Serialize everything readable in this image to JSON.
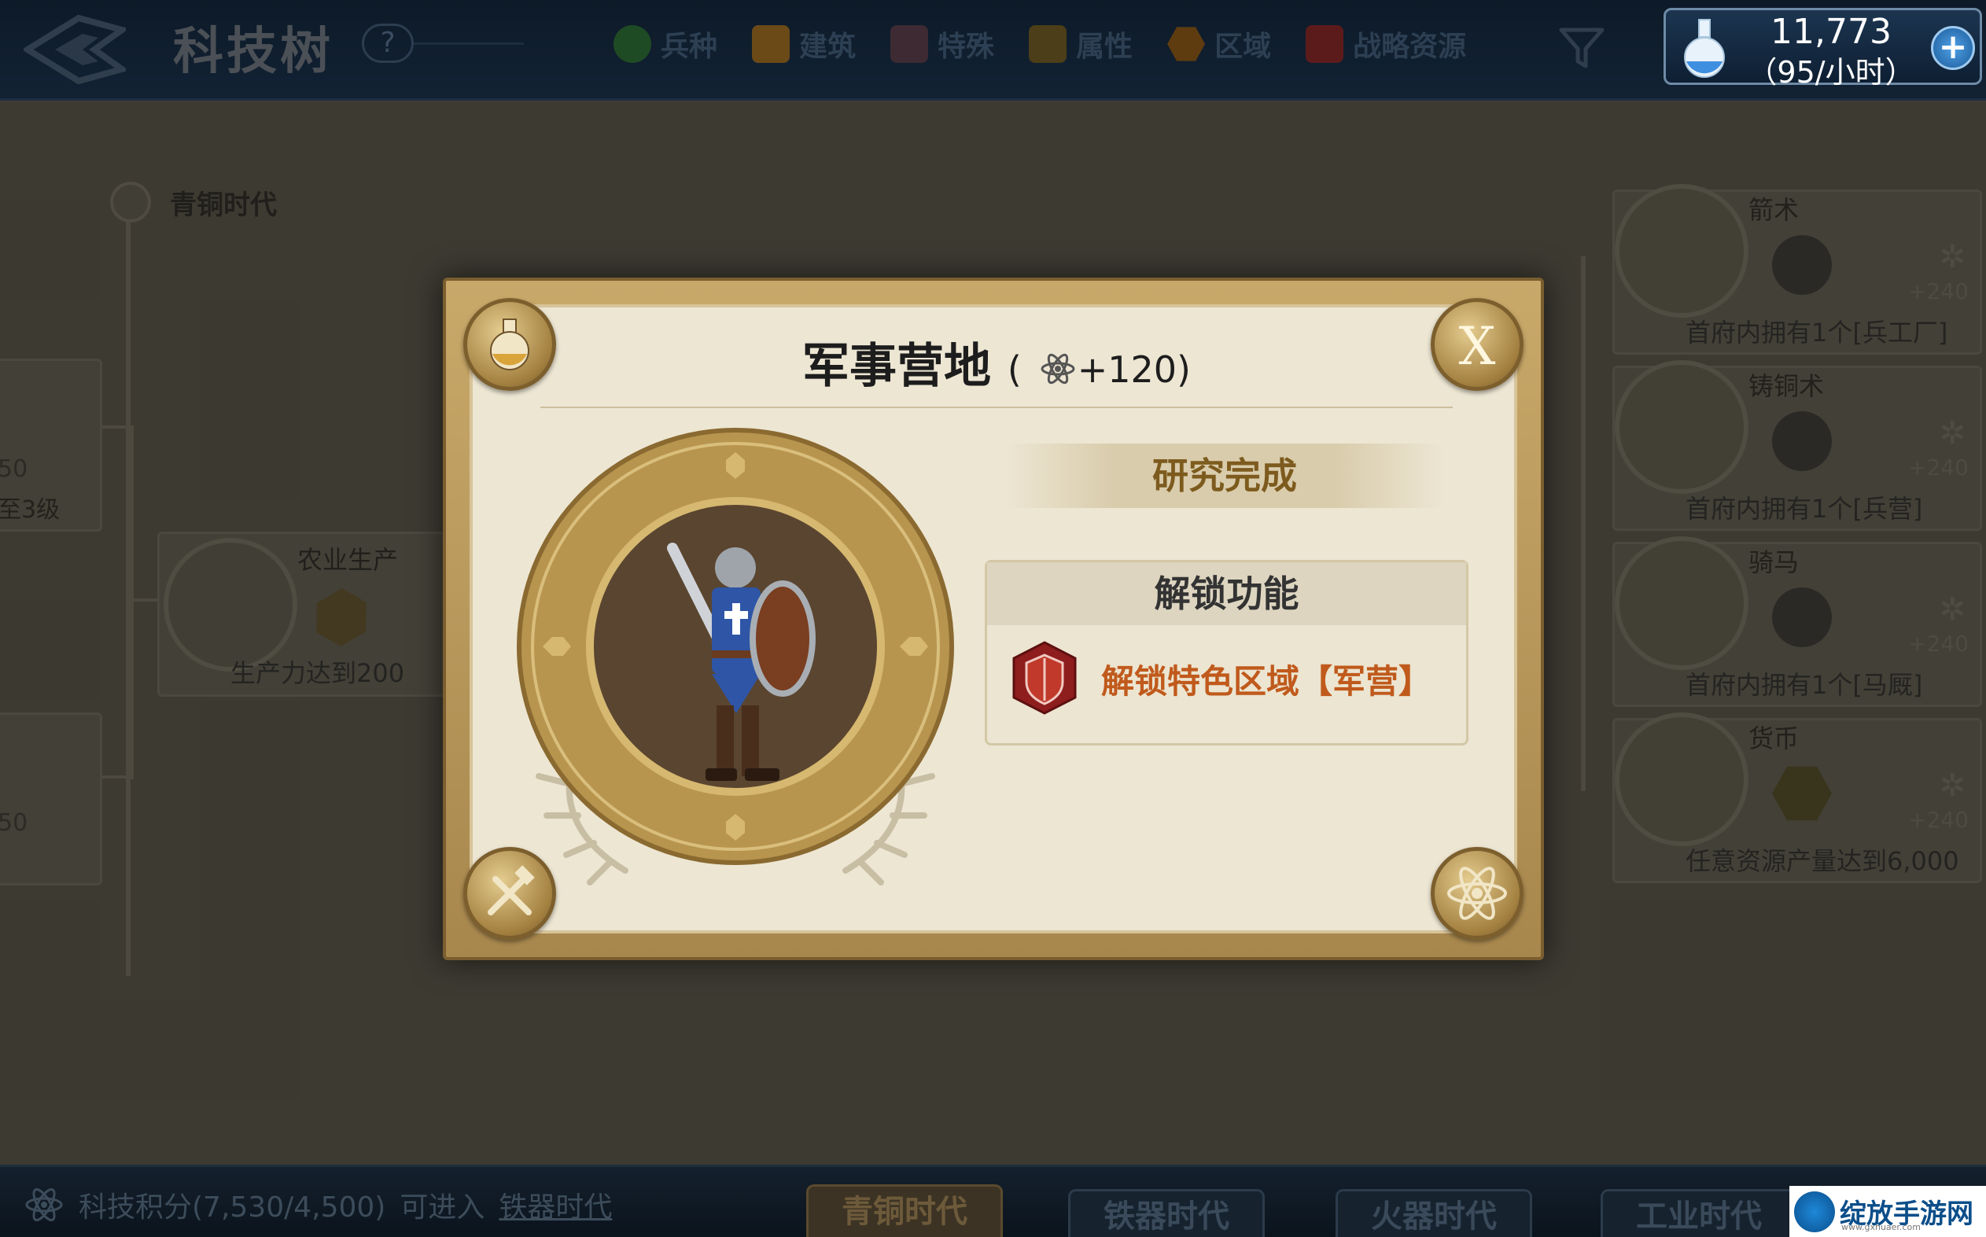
{
  "header": {
    "title": "科技树",
    "help_label": "?",
    "filters": [
      {
        "label": "兵种",
        "color": "#1f4b24"
      },
      {
        "label": "建筑",
        "color": "#6b4a18"
      },
      {
        "label": "特殊",
        "color": "#3d2a33"
      },
      {
        "label": "属性",
        "color": "#4b3e18"
      },
      {
        "label": "区域",
        "color": "#5e3c10"
      },
      {
        "label": "战略资源",
        "color": "#5c1b1b"
      }
    ],
    "resource": {
      "amount": "11,773",
      "rate": "（95/小时）",
      "add_label": "+"
    }
  },
  "tree": {
    "era_label": "青铜时代",
    "left_cards": [
      {
        "points": "50",
        "req": "至3级"
      },
      {
        "points": "50",
        "req": ""
      }
    ],
    "mid_card": {
      "name": "农业生产",
      "req": "生产力达到200"
    },
    "right_cards": [
      {
        "name": "箭术",
        "plus": "+240",
        "req": "首府内拥有1个[兵工厂]"
      },
      {
        "name": "铸铜术",
        "plus": "+240",
        "req": "首府内拥有1个[兵营]"
      },
      {
        "name": "骑马",
        "plus": "+240",
        "req": "首府内拥有1个[马厩]"
      },
      {
        "name": "货币",
        "plus": "+240",
        "req": "任意资源产量达到6,000"
      }
    ]
  },
  "modal": {
    "title": "军事营地",
    "points_open": "(",
    "points": "+120)",
    "close_label": "X",
    "status": "研究完成",
    "unlock_header": "解锁功能",
    "unlock_item": "解锁特色区域【军营】"
  },
  "footer": {
    "points_label": "科技积分(7,530/4,500)",
    "advance_text": "可进入",
    "advance_link": "铁器时代",
    "era_tabs": [
      "青铜时代",
      "铁器时代",
      "火器时代",
      "工业时代"
    ],
    "active_tab": "青铜时代"
  },
  "watermark": {
    "text": "绽放手游网",
    "url": "www.gxhuaer.com"
  }
}
